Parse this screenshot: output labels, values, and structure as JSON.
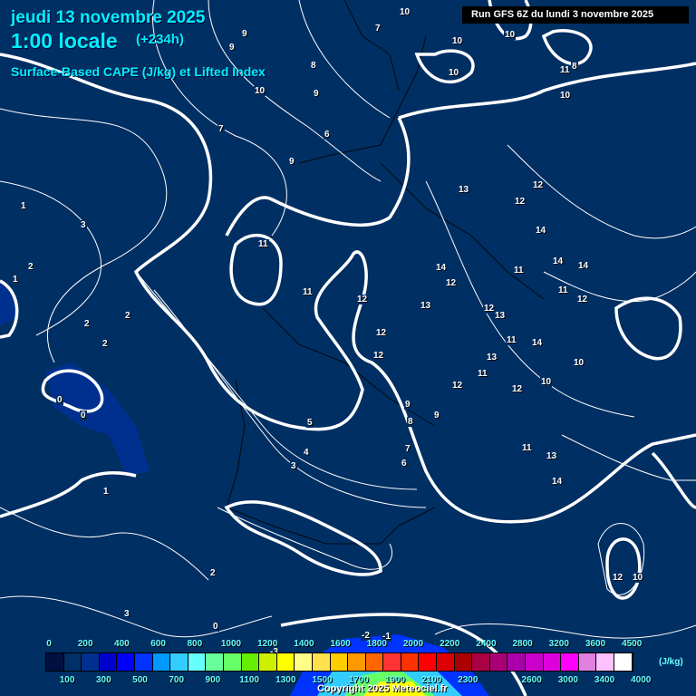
{
  "header": {
    "date": "jeudi 13 novembre 2025",
    "local_time": "1:00 locale",
    "lead_time": "(+234h)",
    "parameter": "Surface-Based CAPE (J/kg) et Lifted Index",
    "run": "Run GFS 6Z du lundi 3 novembre 2025"
  },
  "legend": {
    "unit": "(J/kg)",
    "top_labels": [
      "0",
      "200",
      "400",
      "600",
      "800",
      "1000",
      "1200",
      "1400",
      "1600",
      "1800",
      "2000",
      "2200",
      "2400",
      "2800",
      "3200",
      "3600",
      "4500"
    ],
    "bottom_labels": [
      "100",
      "300",
      "500",
      "700",
      "900",
      "1100",
      "1300",
      "1500",
      "1700",
      "1900",
      "2100",
      "2300",
      "2600",
      "3000",
      "3400",
      "4000"
    ],
    "colors": [
      "#001040",
      "#003066",
      "#00308f",
      "#0000cc",
      "#0000ff",
      "#0033ff",
      "#0099ff",
      "#33ccff",
      "#66ffff",
      "#66ff99",
      "#66ff66",
      "#66ee00",
      "#ccf000",
      "#ffff00",
      "#ffff88",
      "#ffe14d",
      "#ffcc00",
      "#ff9900",
      "#ff6600",
      "#ff3333",
      "#ff3300",
      "#ff0000",
      "#dd0000",
      "#aa0000",
      "#aa0044",
      "#aa0077",
      "#aa00aa",
      "#cc00cc",
      "#dd00dd",
      "#ff00ff",
      "#e080e0",
      "#ffc0ff",
      "#ffffff"
    ]
  },
  "lifted_index_labels": [
    "10",
    "10",
    "10",
    "11",
    "10",
    "8",
    "9",
    "9",
    "8",
    "7",
    "7",
    "6",
    "9",
    "10",
    "9",
    "10",
    "11",
    "11",
    "12",
    "12",
    "12",
    "13",
    "13",
    "12",
    "12",
    "14",
    "14",
    "14",
    "14",
    "12",
    "11",
    "11",
    "12",
    "12",
    "13",
    "14",
    "13",
    "11",
    "11",
    "12",
    "12",
    "10",
    "9",
    "8",
    "9",
    "10",
    "7",
    "6",
    "5",
    "4",
    "3",
    "3",
    "2",
    "2",
    "1",
    "1",
    "0",
    "0",
    "2",
    "2",
    "3",
    "1",
    "2",
    "0",
    "-3",
    "-2",
    "-1",
    "12",
    "10",
    "11",
    "13",
    "14"
  ],
  "copyright": "Copyright 2025 Meteociel.fr"
}
